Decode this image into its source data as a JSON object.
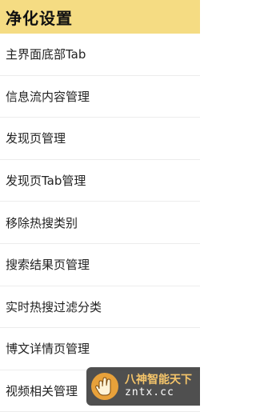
{
  "header": {
    "title": "净化设置",
    "background": "#f5dc83"
  },
  "menu": {
    "items": [
      {
        "label": "主界面底部Tab"
      },
      {
        "label": "信息流内容管理"
      },
      {
        "label": "发现页管理"
      },
      {
        "label": "发现页Tab管理"
      },
      {
        "label": "移除热搜类别"
      },
      {
        "label": "搜索结果页管理"
      },
      {
        "label": "实时热搜过滤分类"
      },
      {
        "label": "博文详情页管理"
      },
      {
        "label": "视频相关管理"
      }
    ]
  },
  "watermark": {
    "title": "八神智能天下",
    "subtitle": "zntx.cc",
    "logo_icon": "hand-logo-icon",
    "accent": "#f5c56a"
  }
}
